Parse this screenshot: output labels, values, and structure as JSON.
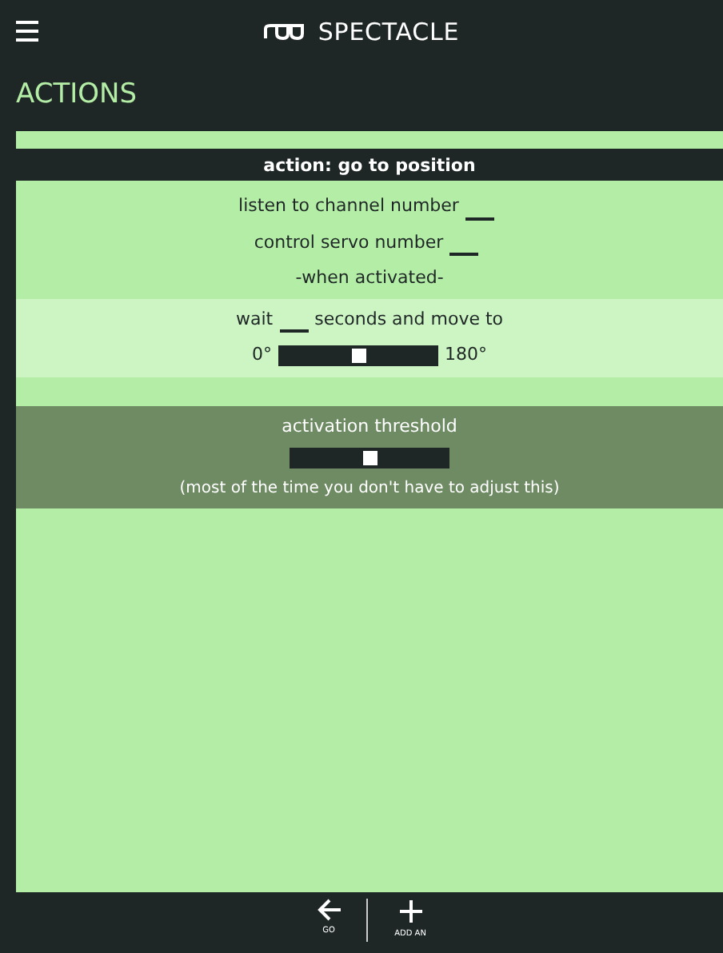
{
  "app": {
    "title": "SPECTACLE"
  },
  "page": {
    "title": "ACTIONS"
  },
  "action": {
    "title": "action: go to position",
    "channel_label": "listen to channel number",
    "servo_label": "control servo number",
    "when_label": "-when activated-",
    "wait_label": "wait",
    "seconds_label": "seconds and move to",
    "position": {
      "min_label": "0°",
      "max_label": "180°",
      "level": 0.5
    },
    "threshold": {
      "title": "activation threshold",
      "level": 0.5,
      "note": "(most of the time you don't have to adjust this)"
    }
  },
  "footer": [
    {
      "kind": "back",
      "label": "GO"
    },
    {
      "kind": "add",
      "label": "ADD AN"
    }
  ]
}
